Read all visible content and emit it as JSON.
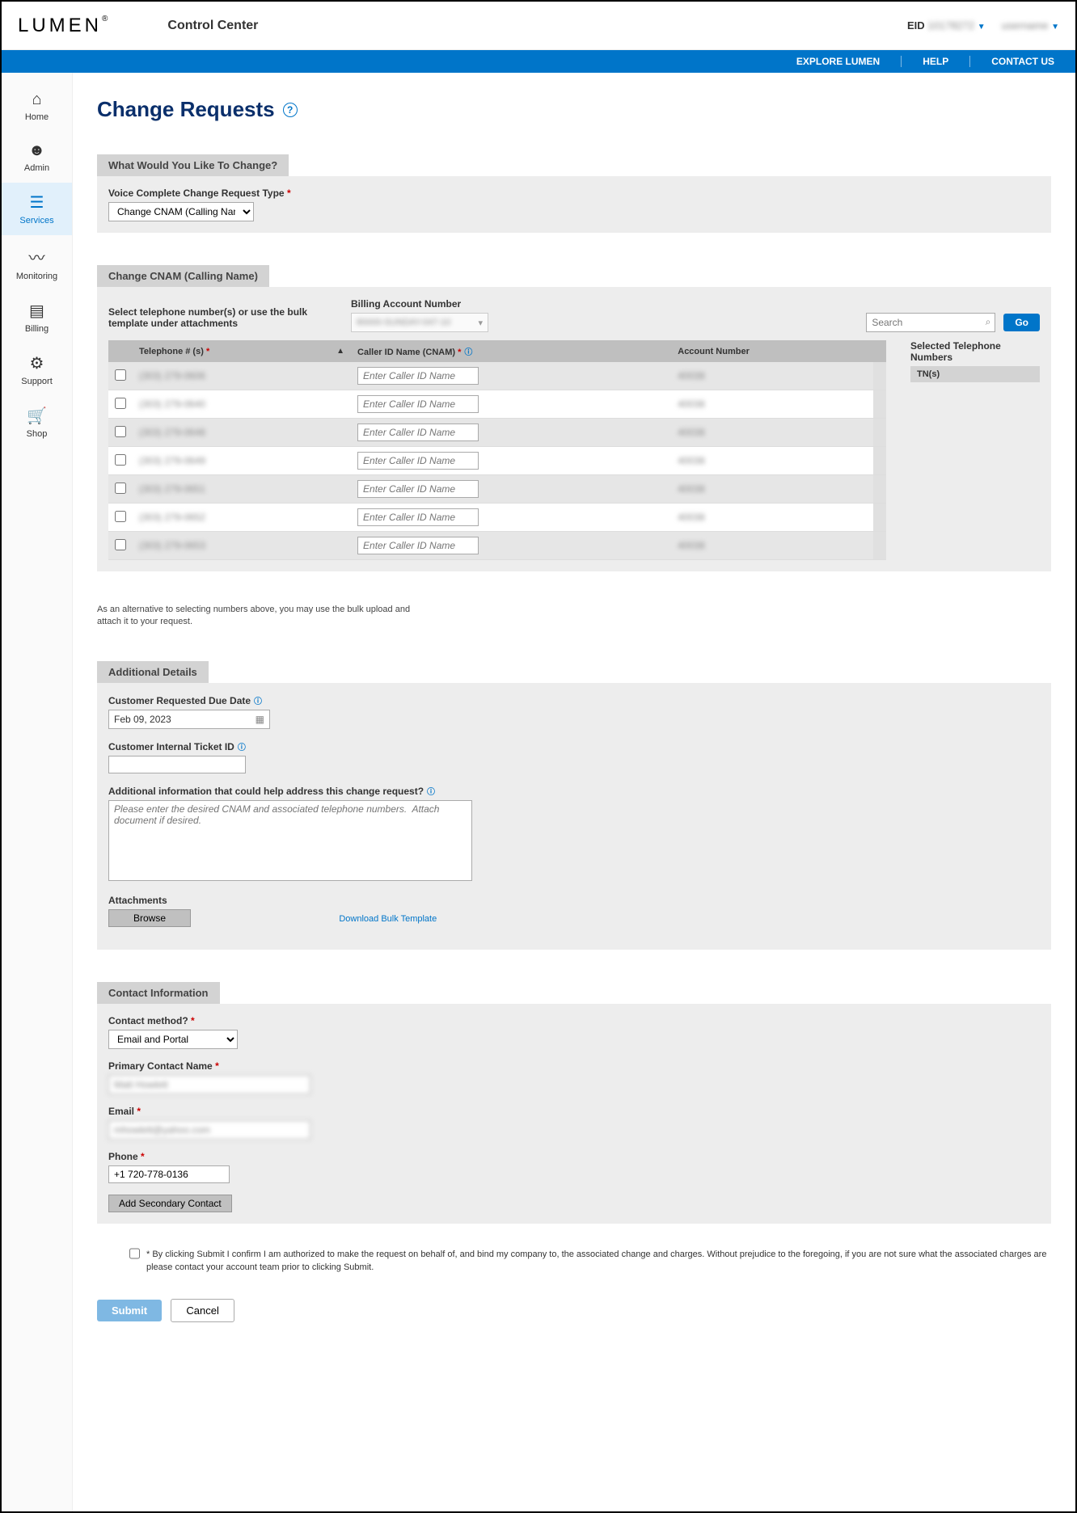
{
  "header": {
    "logo": "LUMEN",
    "app_title": "Control Center",
    "eid_label": "EID",
    "eid_value": "10178272",
    "username": "username"
  },
  "bluebar": {
    "explore": "EXPLORE LUMEN",
    "help": "HELP",
    "contact": "CONTACT US"
  },
  "sidebar": [
    {
      "icon": "⌂",
      "label": "Home"
    },
    {
      "icon": "☻",
      "label": "Admin"
    },
    {
      "icon": "≡",
      "label": "Services"
    },
    {
      "icon": "〰",
      "label": "Monitoring"
    },
    {
      "icon": "▤",
      "label": "Billing"
    },
    {
      "icon": "⚙",
      "label": "Support"
    },
    {
      "icon": "🛒",
      "label": "Shop"
    }
  ],
  "page": {
    "title": "Change Requests"
  },
  "section1": {
    "tab": "What Would You Like To Change?",
    "field_label": "Voice Complete Change Request Type",
    "select_value": "Change CNAM (Calling Nam"
  },
  "section2": {
    "tab": "Change CNAM (Calling Name)",
    "instruction": "Select telephone number(s) or use the bulk template under attachments",
    "billing_label": "Billing Account Number",
    "billing_value": "80000-SUNDAY-047-10",
    "search_placeholder": "Search",
    "go": "Go",
    "selected_title": "Selected Telephone Numbers",
    "tn_header": "TN(s)",
    "columns": {
      "tel": "Telephone # (s)",
      "cnam": "Caller ID Name (CNAM)",
      "account": "Account Number"
    },
    "cnam_placeholder": "Enter Caller ID Name",
    "rows": [
      {
        "tel": "(303) 279-0606",
        "account": "40038"
      },
      {
        "tel": "(303) 279-0640",
        "account": "40038"
      },
      {
        "tel": "(303) 279-0648",
        "account": "40038"
      },
      {
        "tel": "(303) 279-0649",
        "account": "40038"
      },
      {
        "tel": "(303) 279-0651",
        "account": "40038"
      },
      {
        "tel": "(303) 279-0652",
        "account": "40038"
      },
      {
        "tel": "(303) 279-0653",
        "account": "40038"
      }
    ]
  },
  "note": "As an alternative to selecting numbers above, you may use the bulk upload and attach it to your request.",
  "section3": {
    "tab": "Additional Details",
    "due_date_label": "Customer Requested Due Date",
    "due_date_value": "Feb 09, 2023",
    "ticket_label": "Customer Internal Ticket ID",
    "addl_label": "Additional information that could help address this change request?",
    "addl_placeholder": "Please enter the desired CNAM and associated telephone numbers.  Attach document if desired.",
    "attachments_label": "Attachments",
    "browse": "Browse",
    "download": "Download Bulk Template"
  },
  "section4": {
    "tab": "Contact Information",
    "method_label": "Contact method?",
    "method_value": "Email and Portal",
    "name_label": "Primary Contact Name",
    "name_value": "Matt Howlett",
    "email_label": "Email",
    "email_value": "mhowlett@yahoo.com",
    "phone_label": "Phone",
    "phone_value": "+1 720-778-0136",
    "add_secondary": "Add Secondary Contact"
  },
  "disclaimer": "* By clicking Submit I confirm I am authorized to make the request on behalf of, and bind my company to, the associated change and charges. Without prejudice to the foregoing, if you are not sure what the associated charges are please contact your account team prior to clicking Submit.",
  "buttons": {
    "submit": "Submit",
    "cancel": "Cancel"
  }
}
